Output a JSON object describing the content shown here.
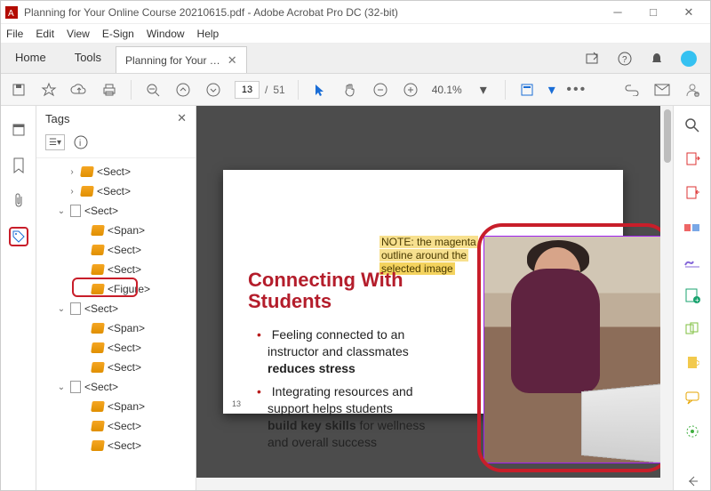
{
  "titlebar": {
    "title": "Planning for Your Online Course 20210615.pdf - Adobe Acrobat Pro DC (32-bit)"
  },
  "menu": {
    "items": [
      "File",
      "Edit",
      "View",
      "E-Sign",
      "Window",
      "Help"
    ]
  },
  "tabs": {
    "home": "Home",
    "tools": "Tools",
    "doc": "Planning for Your …"
  },
  "toolbar": {
    "page_current": "13",
    "page_total": "51",
    "zoom": "40.1%"
  },
  "tags_panel": {
    "title": "Tags",
    "tree": [
      {
        "ind": 30,
        "chev": ">",
        "type": "tag",
        "label": "<Sect>"
      },
      {
        "ind": 30,
        "chev": ">",
        "type": "tag",
        "label": "<Sect>"
      },
      {
        "ind": 18,
        "chev": "v",
        "type": "page",
        "label": "<Sect>"
      },
      {
        "ind": 42,
        "chev": "",
        "type": "tag",
        "label": "<Span>"
      },
      {
        "ind": 42,
        "chev": "",
        "type": "tag",
        "label": "<Sect>"
      },
      {
        "ind": 42,
        "chev": "",
        "type": "tag",
        "label": "<Sect>"
      },
      {
        "ind": 42,
        "chev": "",
        "type": "tag",
        "label": "<Figure>",
        "hl": true
      },
      {
        "ind": 18,
        "chev": "v",
        "type": "page",
        "label": "<Sect>"
      },
      {
        "ind": 42,
        "chev": "",
        "type": "tag",
        "label": "<Span>"
      },
      {
        "ind": 42,
        "chev": "",
        "type": "tag",
        "label": "<Sect>"
      },
      {
        "ind": 42,
        "chev": "",
        "type": "tag",
        "label": "<Sect>"
      },
      {
        "ind": 18,
        "chev": "v",
        "type": "page",
        "label": "<Sect>"
      },
      {
        "ind": 42,
        "chev": "",
        "type": "tag",
        "label": "<Span>"
      },
      {
        "ind": 42,
        "chev": "",
        "type": "tag",
        "label": "<Sect>"
      },
      {
        "ind": 42,
        "chev": "",
        "type": "tag",
        "label": "<Sect>"
      }
    ]
  },
  "annotation": {
    "l1": "NOTE: the magenta",
    "l2": "outline around the",
    "l3": "selected image"
  },
  "slide": {
    "title_l1": "Connecting With",
    "title_l2": "Students",
    "b1a": "Feeling connected to an",
    "b1b": "instructor and classmates",
    "b1c": "reduces stress",
    "b2a": "Integrating resources and",
    "b2b": "support helps students",
    "b2c_bold": "build key skills",
    "b2c_rest": " for wellness",
    "b2d": "and overall success",
    "pagenum": "13"
  },
  "icons": {
    "search": "search",
    "bell": "notifications",
    "user": "account",
    "save": "save",
    "star": "favorite",
    "cloud": "cloud",
    "print": "print",
    "zoom_fit": "fit",
    "zoom_width": "width",
    "zoom_actual": "actual",
    "pointer": "select",
    "hand": "pan",
    "minus": "zoom-out",
    "plus": "zoom-in",
    "more": "more",
    "link": "link",
    "mail": "share-email",
    "person": "account",
    "thumbs": "page-thumbnails",
    "bookmark": "bookmarks",
    "clip": "attachments",
    "tag": "tags",
    "rt_search": "search",
    "rt_export": "export-pdf",
    "rt_import": "create-pdf",
    "rt_edit": "edit-pdf",
    "rt_sign": "fill-sign",
    "rt_redact": "redact",
    "rt_organize": "organize",
    "rt_comment": "comment",
    "rt_stamp": "stamp",
    "rt_more": "more-tools",
    "rt_collapse": "collapse"
  },
  "colors": {
    "annotation_circle": "#c81e2a",
    "magenta_outline": "#a020f0"
  }
}
